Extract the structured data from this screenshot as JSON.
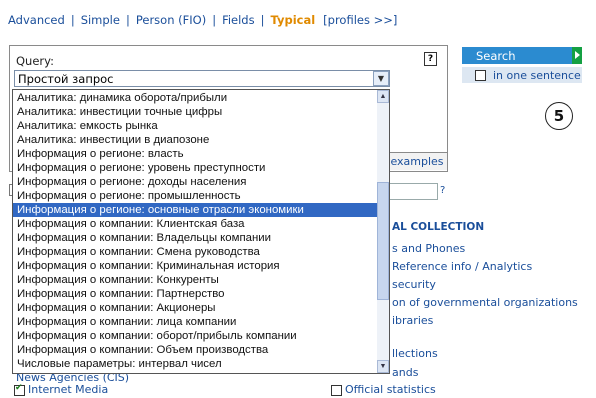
{
  "nav": {
    "items": [
      "Advanced",
      "Simple",
      "Person (FIO)",
      "Fields"
    ],
    "separator": "|",
    "active": "Typical",
    "profiles": "[profiles >>]"
  },
  "query": {
    "label": "Query:",
    "help_icon": "?",
    "selected_value": "Простой запрос",
    "examples_label": "examples"
  },
  "dropdown": {
    "options": [
      "Аналитика: динамика оборота/прибыли",
      "Аналитика: инвестиции точные цифры",
      "Аналитика: емкость рынка",
      "Аналитика: инвестиции в диапозоне",
      "Информация о регионе: власть",
      "Информация о регионе: уровень преступности",
      "Информация о регионе: доходы населения",
      "Информация о регионе: промышленность",
      "Информация о регионе: основные отрасли экономики",
      "Информация о компании: Клиентская база",
      "Информация о компании: Владельцы компании",
      "Информация о компании: Смена руководства",
      "Информация о компании: Криминальная история",
      "Информация о компании: Конкуренты",
      "Информация о компании: Партнерство",
      "Информация о компании: Акционеры",
      "Информация о компании: лица компании",
      "Информация о компании: оборот/прибыль компании",
      "Информация о компании: Объем производства",
      "Числовые параметры: интервал чисел"
    ],
    "selected_index": 8
  },
  "search": {
    "button_label": "Search",
    "in_one_sentence": "in one sentence"
  },
  "step_badge": "5",
  "background": {
    "question_mark": "?",
    "collection_title": "AL COLLECTION",
    "links": [
      "s and Phones",
      "Reference info / Analytics",
      "security",
      "on of governmental organizations",
      "ibraries",
      "llections",
      "ands"
    ],
    "news_agencies": "News Agencies (CIS)",
    "internet_media": "Internet Media",
    "official_statistics": "Official statistics"
  },
  "colors": {
    "link": "#1a4e9a",
    "active_tab": "#e08a00",
    "search_button": "#2b8bd0",
    "selection": "#3168c3"
  }
}
